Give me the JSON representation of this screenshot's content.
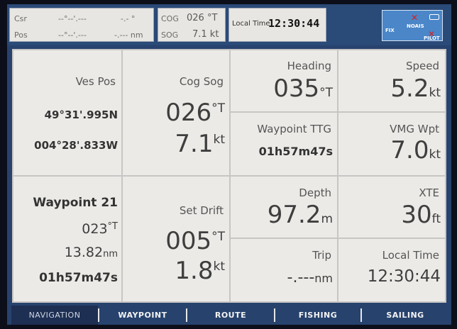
{
  "status": {
    "csr_label": "Csr",
    "csr_value": "--°--'.---",
    "csr_deg": "-.- °",
    "pos_label": "Pos",
    "pos_value": "--°--'.---",
    "pos_nm": "-.--- nm",
    "cog_label": "COG",
    "cog_value": "026 °T",
    "sog_label": "SOG",
    "sog_value": "7.1 kt",
    "local_time_label": "Local Time",
    "local_time_value": "12:30:44",
    "badges": [
      "FIX",
      "NOAIS",
      "PILOT"
    ]
  },
  "panels": {
    "ves_pos": {
      "label": "Ves Pos",
      "lat": "49°31'.995N",
      "lon": "004°28'.833W"
    },
    "cog_sog": {
      "label": "Cog Sog",
      "cog": "026",
      "cog_unit": "°T",
      "sog": "7.1",
      "sog_unit": "kt"
    },
    "heading": {
      "label": "Heading",
      "value": "035",
      "unit": "°T"
    },
    "speed": {
      "label": "Speed",
      "value": "5.2",
      "unit": "kt"
    },
    "waypoint_ttg": {
      "label": "Waypoint TTG",
      "value": "01h57m47s"
    },
    "vmg_wpt": {
      "label": "VMG Wpt",
      "value": "7.0",
      "unit": "kt"
    },
    "waypoint": {
      "label": "Waypoint 21",
      "bearing": "023",
      "bearing_unit": "°T",
      "distance": "13.82",
      "distance_unit": "nm",
      "ttg": "01h57m47s"
    },
    "set_drift": {
      "label": "Set Drift",
      "set": "005",
      "set_unit": "°T",
      "drift": "1.8",
      "drift_unit": "kt"
    },
    "depth": {
      "label": "Depth",
      "value": "97.2",
      "unit": "m"
    },
    "xte": {
      "label": "XTE",
      "value": "30",
      "unit": "ft"
    },
    "trip": {
      "label": "Trip",
      "value": "-.---",
      "unit": "nm"
    },
    "local_time": {
      "label": "Local Time",
      "value": "12:30:44"
    }
  },
  "nav": {
    "tabs": [
      "NAVIGATION",
      "WAYPOINT",
      "ROUTE",
      "FISHING",
      "SAILING"
    ],
    "active": "NAVIGATION"
  },
  "colors": {
    "frame": "#27426d",
    "panel": "#eceae7",
    "active_tab": "#1d2f52"
  }
}
